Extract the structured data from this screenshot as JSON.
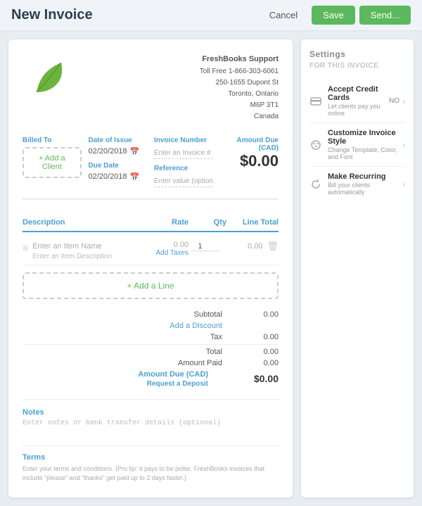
{
  "header": {
    "title": "New Invoice",
    "cancel_label": "Cancel",
    "save_label": "Save",
    "send_label": "Send..."
  },
  "company": {
    "name": "FreshBooks Support",
    "phone": "Toll Free 1-866-303-6061",
    "address_line1": "250-1655 Dupont St",
    "address_line2": "Toronto, Ontario",
    "address_line3": "M6P 3T1",
    "address_line4": "Canada"
  },
  "invoice": {
    "billed_to_label": "Billed To",
    "add_client_label": "+ Add a Client",
    "date_of_issue_label": "Date of Issue",
    "date_of_issue_value": "02/20/2018",
    "due_date_label": "Due Date",
    "due_date_value": "02/20/2018",
    "invoice_number_label": "Invoice Number",
    "invoice_number_placeholder": "Enter an Invoice #",
    "reference_label": "Reference",
    "reference_placeholder": "Enter value (optional)",
    "amount_due_label": "Amount Due (CAD)",
    "amount_due_value": "$0.00"
  },
  "line_items": {
    "description_header": "Description",
    "rate_header": "Rate",
    "qty_header": "Qty",
    "line_total_header": "Line Total",
    "item_name_placeholder": "Enter an Item Name",
    "item_desc_placeholder": "Enter an Item Description",
    "rate_value": "0.00",
    "add_taxes_label": "Add Taxes",
    "qty_value": "1",
    "line_total_value": "0.00",
    "add_line_label": "+ Add a Line"
  },
  "totals": {
    "subtotal_label": "Subtotal",
    "subtotal_value": "0.00",
    "discount_label": "Add a Discount",
    "tax_label": "Tax",
    "tax_value": "0.00",
    "total_label": "Total",
    "total_value": "0.00",
    "amount_paid_label": "Amount Paid",
    "amount_paid_value": "0.00",
    "amount_due_label": "Amount Due (CAD)",
    "amount_due_value": "$0.00",
    "request_deposit_label": "Request a Deposit"
  },
  "notes": {
    "label": "Notes",
    "placeholder": "Enter notes or bank transfer details (optional)"
  },
  "terms": {
    "label": "Terms",
    "placeholder": "Enter your terms and conditions.",
    "hint": "Enter your terms and conditions. (Pro tip: it pays to be polite. FreshBooks invoices that include \"please\" and \"thanks\" get paid up to 2 days faster.)"
  },
  "settings": {
    "title": "Settings",
    "subtitle": "FOR THIS INVOICE",
    "items": [
      {
        "icon": "credit-card",
        "label": "Accept Credit Cards",
        "desc": "Let clients pay you online",
        "badge": "NO",
        "has_chevron": true
      },
      {
        "icon": "palette",
        "label": "Customize Invoice Style",
        "desc": "Change Template, Color, and Font",
        "badge": "",
        "has_chevron": true
      },
      {
        "icon": "refresh",
        "label": "Make Recurring",
        "desc": "Bill your clients automatically",
        "badge": "",
        "has_chevron": true
      }
    ]
  }
}
